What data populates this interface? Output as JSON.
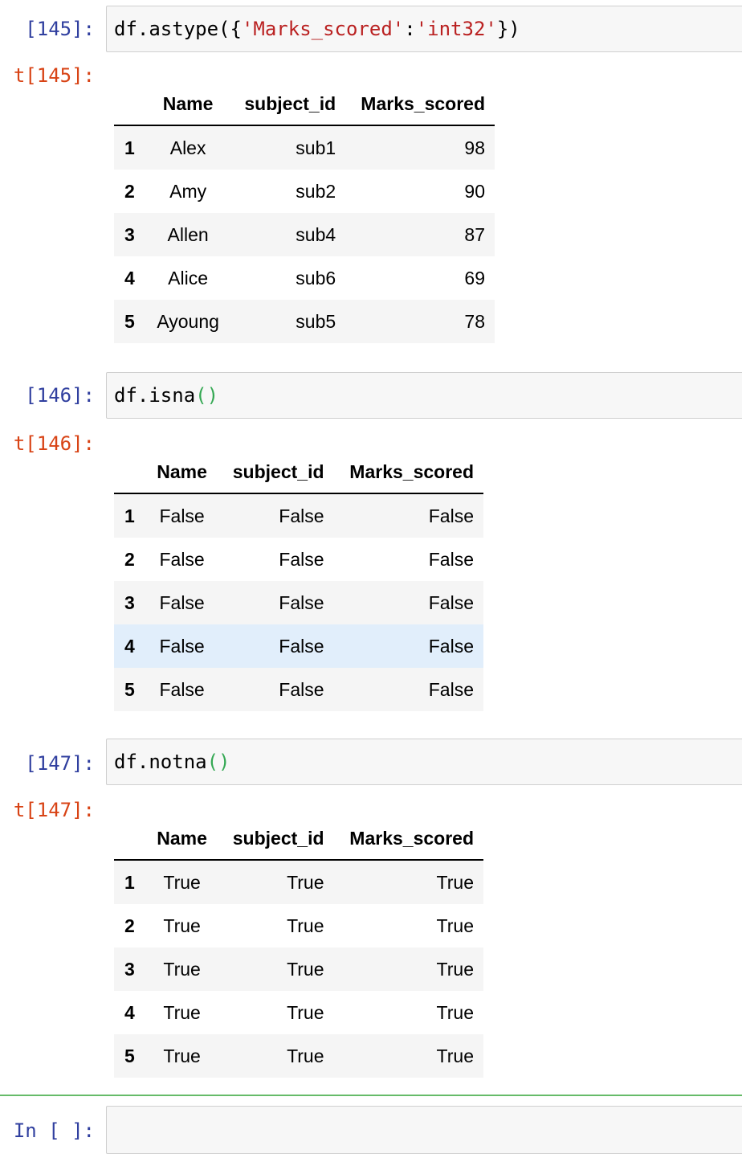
{
  "cells": [
    {
      "in_prompt": "[145]:",
      "out_prompt": "t[145]:",
      "code_tokens": [
        {
          "text": "df.astype({",
          "kind": "plain"
        },
        {
          "text": "'Marks_scored'",
          "kind": "str"
        },
        {
          "text": ":",
          "kind": "plain"
        },
        {
          "text": "'int32'",
          "kind": "str"
        },
        {
          "text": "})",
          "kind": "plain"
        }
      ],
      "columns": [
        "Name",
        "subject_id",
        "Marks_scored"
      ],
      "rows": [
        {
          "index": "1",
          "values": [
            "Alex",
            "sub1",
            "98"
          ]
        },
        {
          "index": "2",
          "values": [
            "Amy",
            "sub2",
            "90"
          ]
        },
        {
          "index": "3",
          "values": [
            "Allen",
            "sub4",
            "87"
          ]
        },
        {
          "index": "4",
          "values": [
            "Alice",
            "sub6",
            "69"
          ]
        },
        {
          "index": "5",
          "values": [
            "Ayoung",
            "sub5",
            "78"
          ]
        }
      ]
    },
    {
      "in_prompt": "[146]:",
      "out_prompt": "t[146]:",
      "code_tokens": [
        {
          "text": "df.isna",
          "kind": "plain"
        },
        {
          "text": "()",
          "kind": "paren"
        }
      ],
      "columns": [
        "Name",
        "subject_id",
        "Marks_scored"
      ],
      "rows": [
        {
          "index": "1",
          "values": [
            "False",
            "False",
            "False"
          ]
        },
        {
          "index": "2",
          "values": [
            "False",
            "False",
            "False"
          ]
        },
        {
          "index": "3",
          "values": [
            "False",
            "False",
            "False"
          ]
        },
        {
          "index": "4",
          "values": [
            "False",
            "False",
            "False"
          ]
        },
        {
          "index": "5",
          "values": [
            "False",
            "False",
            "False"
          ]
        }
      ]
    },
    {
      "in_prompt": "[147]:",
      "out_prompt": "t[147]:",
      "code_tokens": [
        {
          "text": "df.notna",
          "kind": "plain"
        },
        {
          "text": "()",
          "kind": "paren"
        }
      ],
      "columns": [
        "Name",
        "subject_id",
        "Marks_scored"
      ],
      "rows": [
        {
          "index": "1",
          "values": [
            "True",
            "True",
            "True"
          ]
        },
        {
          "index": "2",
          "values": [
            "True",
            "True",
            "True"
          ]
        },
        {
          "index": "3",
          "values": [
            "True",
            "True",
            "True"
          ]
        },
        {
          "index": "4",
          "values": [
            "True",
            "True",
            "True"
          ]
        },
        {
          "index": "5",
          "values": [
            "True",
            "True",
            "True"
          ]
        }
      ]
    }
  ],
  "empty_cell": {
    "in_prompt": "In [ ]:"
  },
  "hovered_row": "cells.1.rows.3",
  "colors": {
    "in_prompt": "#303f9f",
    "out_prompt": "#d84315",
    "string": "#ba2121",
    "paren": "#34a853",
    "selected_border": "#66bb6a"
  }
}
